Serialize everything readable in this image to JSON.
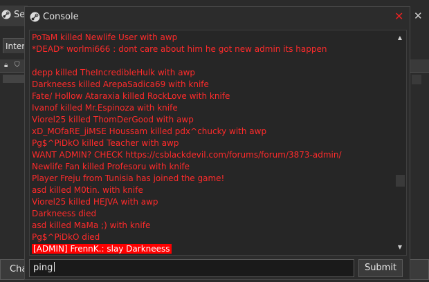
{
  "background_window": {
    "title": "Se",
    "tab_label": "Inter",
    "connect_left_label": "Cha",
    "connect_right_label": "ect"
  },
  "console": {
    "title": "Console",
    "close_icon": "close-icon",
    "log_lines": [
      "PoTaM killed Newlife User with awp",
      "*DEAD* worlmi666 :  dont care about him he got new admin its happen",
      "",
      "depp killed TheIncredibleHulk with awp",
      "Darkneess killed ArepaSadica69 with knife",
      "Fate/ Hollow Ataraxia killed RockLove with knife",
      "Ivanof killed Mr.Espinoza with knife",
      "Viorel25 killed ThomDerGood with awp",
      "xD_MOfaRE_jiMSE Houssam killed pdx^chucky with awp",
      "Pg$^PiDkO killed Teacher with awp",
      "WANT ADMIN? CHECK https://csblackdevil.com/forums/forum/3873-admin/",
      "Newlife Fan killed Profesoru with knife",
      "Player Freju from Tunisia has joined the game!",
      "asd killed M0tin. with knife",
      "Viorel25 killed HEJVA with awp",
      "Darkneess died",
      "asd killed MaMa ;) with knife",
      "Pg$^PiDkO died"
    ],
    "highlight_line": "[ADMIN] FrennK.: slay Darkneess",
    "input_value": "ping",
    "submit_label": "Submit"
  },
  "colors": {
    "log_text": "#ff2b2b",
    "highlight_bg": "#ff0000",
    "close": "#e62222"
  }
}
